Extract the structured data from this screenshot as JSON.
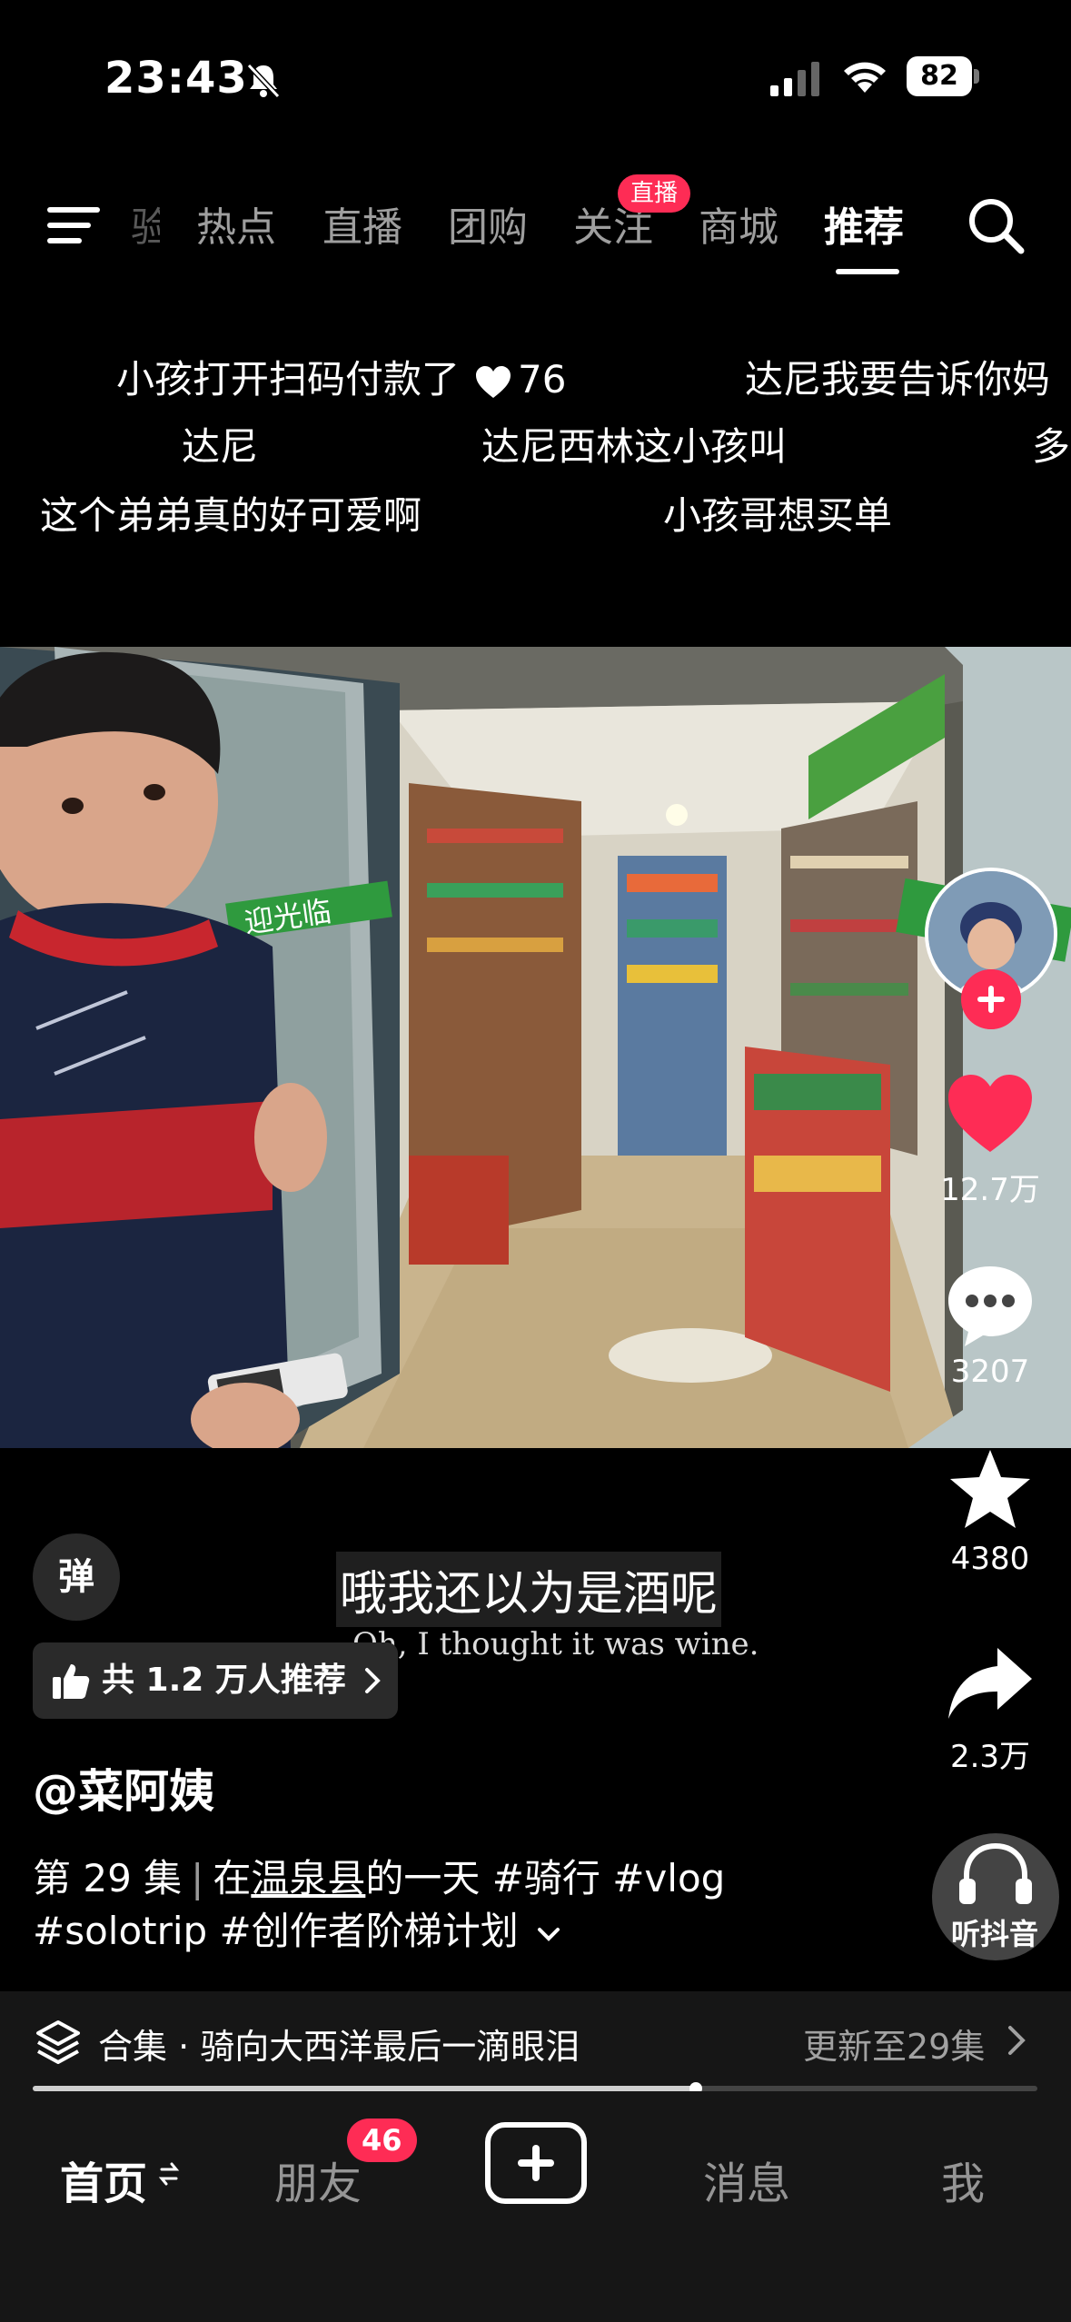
{
  "status_bar": {
    "time": "23:43",
    "battery": "82"
  },
  "top_nav": {
    "faded_tab": "验",
    "tabs": [
      "热点",
      "直播",
      "团购",
      "关注",
      "商城",
      "推荐"
    ],
    "live_badge": "直播",
    "active_tab": "推荐"
  },
  "danmaku": [
    {
      "text": "小孩打开扫码付款了",
      "likes": "76"
    },
    {
      "text": "达尼我要告诉你妈"
    },
    {
      "text": "达尼"
    },
    {
      "text": "达尼西林这小孩叫"
    },
    {
      "text": "多"
    },
    {
      "text": "这个弟弟真的好可爱啊"
    },
    {
      "text": "小孩哥想买单"
    }
  ],
  "video": {
    "store_sign": "迎光临",
    "subtitle_cn": "哦我还以为是酒呢",
    "subtitle_en": "Oh, I thought it was wine."
  },
  "rail": {
    "likes": "12.7万",
    "comments": "3207",
    "favorites": "4380",
    "shares": "2.3万",
    "listen_label": "听抖音"
  },
  "barrage_button": "弹",
  "recommend": "共 1.2 万人推荐",
  "author": "@菜阿姨",
  "description": {
    "episode": "第 29 集",
    "prefix": "在",
    "location": "温泉县",
    "rest": "的一天 #骑行 #vlog",
    "line2": "#solotrip #创作者阶梯计划"
  },
  "collection": {
    "title": "合集 · 骑向大西洋最后一滴眼泪",
    "update": "更新至29集",
    "progress": 0.66
  },
  "bottom_nav": {
    "home": "首页",
    "friends": "朋友",
    "friends_badge": "46",
    "messages": "消息",
    "me": "我"
  },
  "colors": {
    "accent": "#fe2c55",
    "background": "#000000",
    "bar": "#161616"
  },
  "icons": [
    "bell-muted-icon",
    "signal-icon",
    "wifi-icon",
    "menu-icon",
    "search-icon",
    "heart-icon",
    "comment-icon",
    "star-icon",
    "share-icon",
    "headphones-icon",
    "thumbs-up-icon",
    "layers-icon",
    "chevron-right-icon",
    "plus-icon"
  ]
}
